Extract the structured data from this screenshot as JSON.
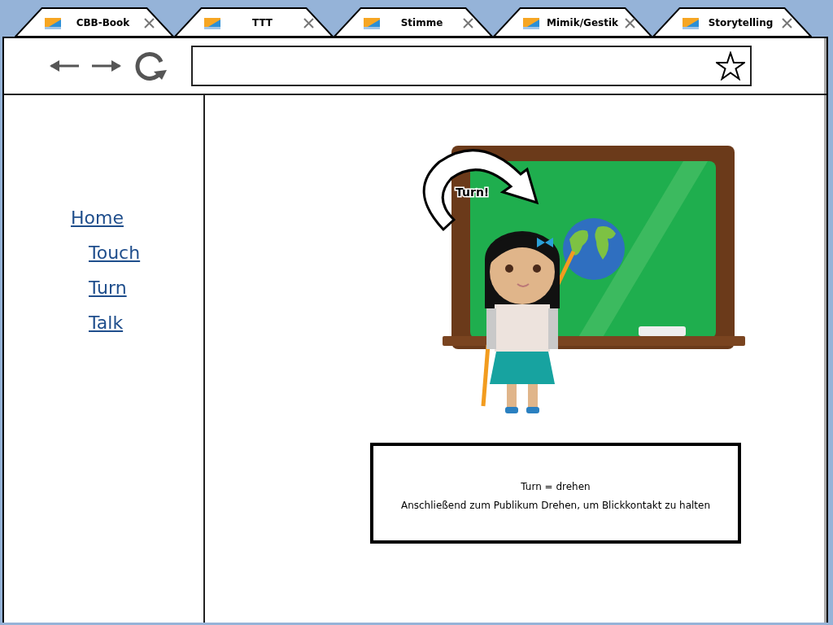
{
  "tabs": [
    {
      "label": "CBB-Book"
    },
    {
      "label": "TTT"
    },
    {
      "label": "Stimme"
    },
    {
      "label": "Mimik/Gestik"
    },
    {
      "label": "Storytelling"
    }
  ],
  "sidebar": {
    "items": [
      {
        "label": "Home",
        "children": [
          {
            "label": "Touch"
          },
          {
            "label": "Turn"
          },
          {
            "label": "Talk"
          }
        ]
      }
    ]
  },
  "illustration": {
    "label": "Turn!"
  },
  "caption": {
    "lines": [
      "Turn = drehen",
      "Anschließend zum Publikum Drehen, um Blickkontakt zu halten"
    ]
  }
}
